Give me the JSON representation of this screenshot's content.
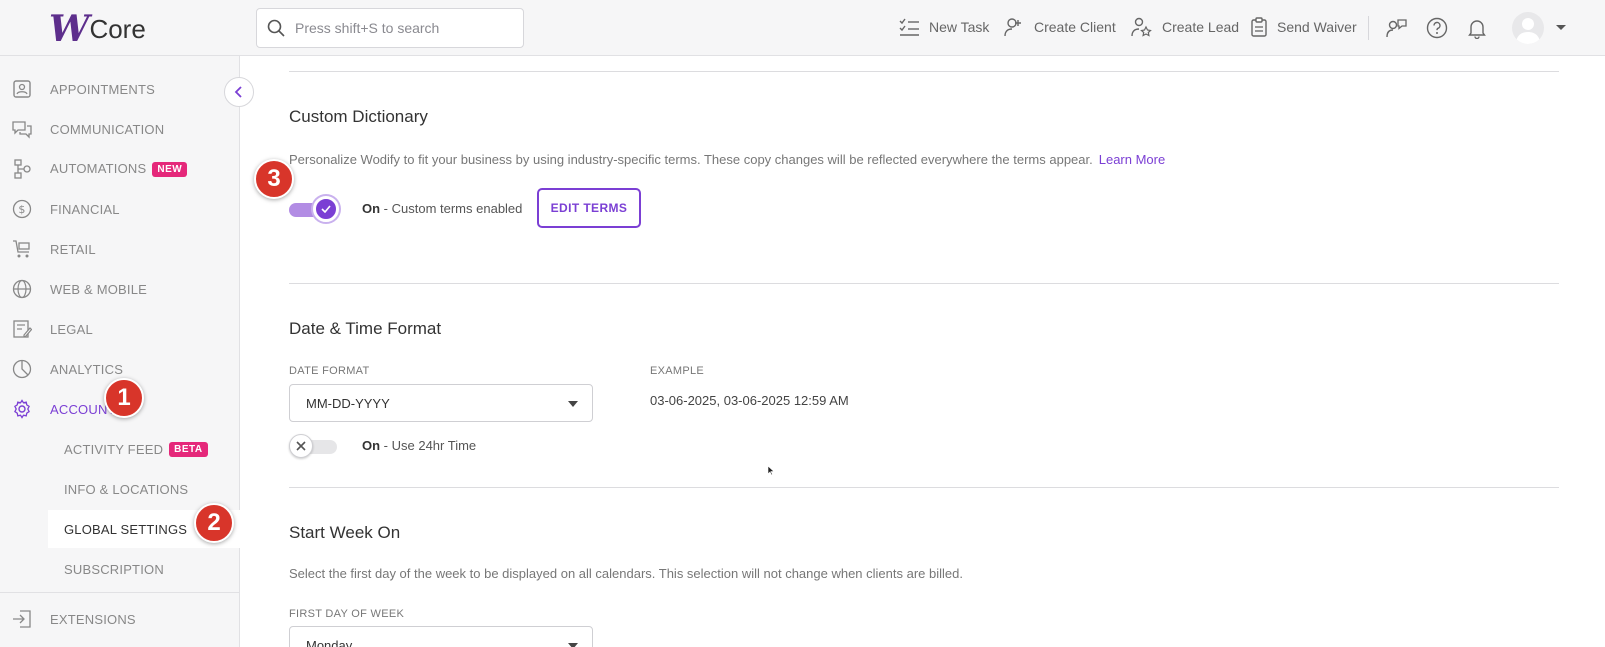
{
  "header": {
    "logo_mark": "W",
    "logo_text": "Core",
    "search_placeholder": "Press shift+S to search",
    "actions": [
      {
        "label": "New Task",
        "icon": "task-list-icon"
      },
      {
        "label": "Create Client",
        "icon": "add-person-icon"
      },
      {
        "label": "Create Lead",
        "icon": "lead-star-icon"
      },
      {
        "label": "Send Waiver",
        "icon": "clipboard-icon"
      }
    ],
    "icons": [
      "feedback-icon",
      "help-icon",
      "bell-icon",
      "avatar",
      "chevron-down-icon"
    ]
  },
  "sidebar": {
    "items": [
      {
        "label": "APPOINTMENTS",
        "icon": "calendar-book-icon"
      },
      {
        "label": "COMMUNICATION",
        "icon": "chat-bubbles-icon"
      },
      {
        "label": "AUTOMATIONS",
        "icon": "automation-flow-icon",
        "badge": "NEW"
      },
      {
        "label": "FINANCIAL",
        "icon": "dollar-circle-icon"
      },
      {
        "label": "RETAIL",
        "icon": "cart-icon"
      },
      {
        "label": "WEB & MOBILE",
        "icon": "globe-icon"
      },
      {
        "label": "LEGAL",
        "icon": "document-edit-icon"
      },
      {
        "label": "ANALYTICS",
        "icon": "pie-chart-icon"
      },
      {
        "label": "ACCOUNT",
        "icon": "gear-icon",
        "active": true
      }
    ],
    "sub_items": [
      {
        "label": "ACTIVITY FEED",
        "badge": "BETA"
      },
      {
        "label": "INFO & LOCATIONS"
      },
      {
        "label": "GLOBAL SETTINGS",
        "selected": true
      },
      {
        "label": "SUBSCRIPTION"
      }
    ],
    "extensions": {
      "label": "EXTENSIONS",
      "icon": "extension-exit-icon"
    }
  },
  "steps": [
    "1",
    "2",
    "3"
  ],
  "main": {
    "custom_dictionary": {
      "title": "Custom Dictionary",
      "description": "Personalize Wodify to fit your business by using industry-specific terms. These copy changes will be reflected everywhere the terms appear.",
      "learn_more": "Learn More",
      "toggle_state": "On",
      "toggle_text": " - Custom terms enabled",
      "edit_button": "EDIT TERMS"
    },
    "date_time": {
      "title": "Date & Time Format",
      "date_format_label": "DATE FORMAT",
      "date_format_value": "MM-DD-YYYY",
      "example_label": "EXAMPLE",
      "example_value": "03-06-2025, 03-06-2025 12:59 AM",
      "toggle_state": "On",
      "toggle_text": " - Use 24hr Time"
    },
    "start_week": {
      "title": "Start Week On",
      "description": "Select the first day of the week to be displayed on all calendars. This selection will not change when clients are billed.",
      "first_day_label": "FIRST DAY OF WEEK",
      "first_day_value": "Monday"
    }
  },
  "colors": {
    "accent": "#7b3fd4",
    "badge": "#e5287a",
    "step_marker": "#d8352a"
  }
}
